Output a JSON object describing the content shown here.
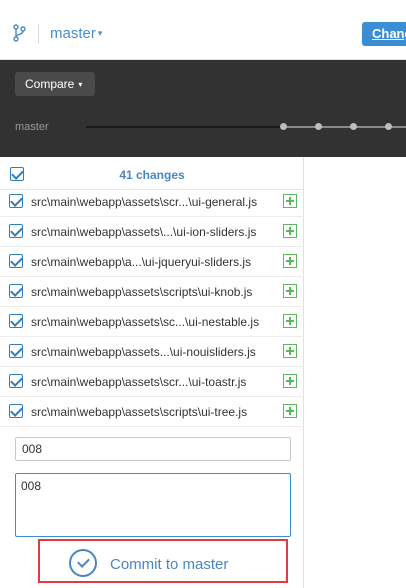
{
  "topbar": {
    "branch_icon": "branch-icon",
    "branch_name": "master",
    "caret": "▾",
    "changes_button_label": "Chang"
  },
  "compare": {
    "button_label": "Compare",
    "caret": "▾",
    "timeline_label": "master"
  },
  "changes": {
    "count_label": "41 changes",
    "files": [
      {
        "path": "src\\main\\webapp\\assets\\scr...\\ui-general.js",
        "status": "added"
      },
      {
        "path": "src\\main\\webapp\\assets\\...\\ui-ion-sliders.js",
        "status": "added"
      },
      {
        "path": "src\\main\\webapp\\a...\\ui-jqueryui-sliders.js",
        "status": "added"
      },
      {
        "path": "src\\main\\webapp\\assets\\scripts\\ui-knob.js",
        "status": "added"
      },
      {
        "path": "src\\main\\webapp\\assets\\sc...\\ui-nestable.js",
        "status": "added"
      },
      {
        "path": "src\\main\\webapp\\assets...\\ui-nouisliders.js",
        "status": "added"
      },
      {
        "path": "src\\main\\webapp\\assets\\scr...\\ui-toastr.js",
        "status": "added"
      },
      {
        "path": "src\\main\\webapp\\assets\\scripts\\ui-tree.js",
        "status": "added"
      }
    ]
  },
  "commit": {
    "summary_value": "008",
    "description_value": "008",
    "button_label": "Commit to master"
  },
  "colors": {
    "accent": "#3b8ed3",
    "link_blue": "#4a86c0",
    "added_green": "#5cb85c",
    "highlight_red": "#e23b3b",
    "dark_band": "#323232"
  }
}
